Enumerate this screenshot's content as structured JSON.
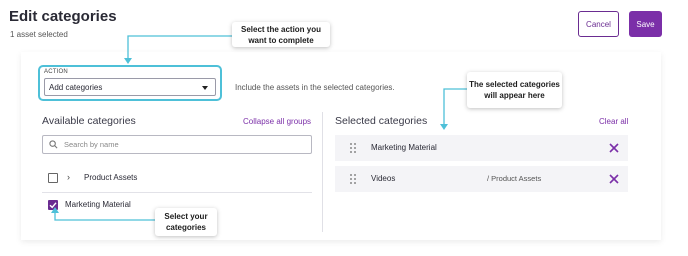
{
  "header": {
    "title": "Edit categories",
    "subtitle": "1 asset selected",
    "cancel_label": "Cancel",
    "save_label": "Save"
  },
  "action": {
    "label": "ACTION",
    "value": "Add categories",
    "description": "Include the assets in the selected categories."
  },
  "available": {
    "title": "Available categories",
    "collapse_label": "Collapse all groups",
    "search_placeholder": "Search by name",
    "items": [
      {
        "label": "Product Assets",
        "checked": false,
        "expandable": true
      },
      {
        "label": "Marketing Material",
        "checked": true,
        "expandable": false
      }
    ]
  },
  "selected": {
    "title": "Selected categories",
    "clear_label": "Clear all",
    "items": [
      {
        "label": "Marketing Material",
        "path": ""
      },
      {
        "label": "Videos",
        "path": "/ Product Assets"
      }
    ]
  },
  "callouts": {
    "action": "Select the action you want to complete",
    "selected": "The selected categories will appear here",
    "categories": "Select your categories"
  },
  "colors": {
    "accent": "#7b2fa8",
    "callout_line": "#4ec0d8"
  }
}
